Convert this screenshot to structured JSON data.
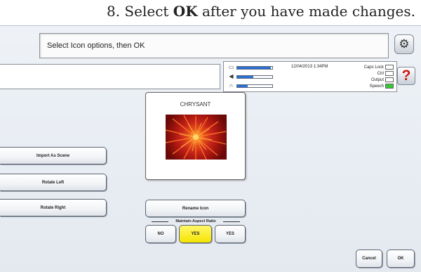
{
  "caption": {
    "step": "8. Select ",
    "emphasis": "OK",
    "rest": " after you have made changes."
  },
  "prompt": {
    "text": "Select Icon options, then OK"
  },
  "status": {
    "datetime": "12/04/2013 1:34PM",
    "meters": [
      {
        "icon": "battery-icon",
        "level": 0.95
      },
      {
        "icon": "speaker-icon",
        "level": 0.45
      },
      {
        "icon": "headphones-icon",
        "level": 0.3
      }
    ],
    "indicators": [
      {
        "label": "Caps Lock",
        "on": false
      },
      {
        "label": "Ctrl",
        "on": false
      },
      {
        "label": "Output",
        "on": false
      },
      {
        "label": "Speech",
        "on": true
      }
    ]
  },
  "help": {
    "label": "?"
  },
  "gear": {
    "icon": "gear-icon"
  },
  "icon_preview": {
    "name": "CHRYSANT"
  },
  "buttons": {
    "import_as_scene": "Import As Scene",
    "rotate_left": "Rotate Left",
    "rotate_right": "Rotate Right",
    "rename_icon": "Rename Icon",
    "no": "NO",
    "yes_selected": "YES",
    "yes": "YES",
    "cancel": "Cancel",
    "ok": "OK"
  },
  "aspect_ratio": {
    "label": "Maintain Aspect Ratio"
  },
  "colors": {
    "selected": "#f4e400",
    "speech_on": "#34c934",
    "help_red": "#d01818"
  }
}
